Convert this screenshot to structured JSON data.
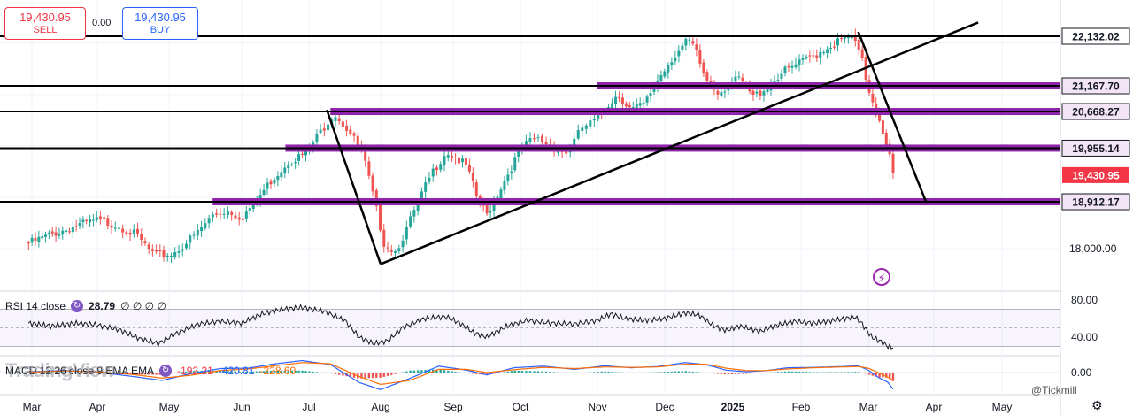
{
  "trade_panel": {
    "sell_price": "19,430.95",
    "sell_label": "SELL",
    "spread": "0.00",
    "buy_price": "19,430.95",
    "buy_label": "BUY"
  },
  "indicators": {
    "rsi": {
      "label": "RSI 14 close",
      "value": "28.79",
      "extra": "∅ ∅ ∅ ∅"
    },
    "macd": {
      "label": "MACD 12 26 close 9 EMA EMA",
      "macd": "-192.21",
      "signal": "-420.81",
      "hist": "-228.60"
    }
  },
  "watermark": "TradingView",
  "credit": "@Tickmill",
  "colors": {
    "up": "#26a69a",
    "down": "#ef5350",
    "level": "#8e24aa",
    "line": "#000000",
    "rsi": "#131722",
    "macd": "#2962ff",
    "signal": "#ff6d00",
    "price_label": "#f23645"
  },
  "icons": {
    "indicator": "loop-icon",
    "alert": "lightning-icon",
    "settings": "gear-icon"
  },
  "chart_data": {
    "type": "candlestick",
    "instrument_price": 19430.95,
    "x_axis": [
      "Mar",
      "Apr",
      "May",
      "Jun",
      "Jul",
      "Aug",
      "Sep",
      "Oct",
      "Nov",
      "Dec",
      "2025",
      "Feb",
      "Mar",
      "Apr",
      "May"
    ],
    "y_axis_labels": [
      "18,000.00"
    ],
    "price_labels": [
      {
        "text": "22,132.02",
        "value": 22132.02,
        "style": "line"
      },
      {
        "text": "21,167.70",
        "value": 21167.7,
        "style": "level"
      },
      {
        "text": "20,668.27",
        "value": 20668.27,
        "style": "level"
      },
      {
        "text": "19,955.14",
        "value": 19955.14,
        "style": "level"
      },
      {
        "text": "19,430.95",
        "value": 19430.95,
        "style": "current"
      },
      {
        "text": "18,912.17",
        "value": 18912.17,
        "style": "level"
      }
    ],
    "horizontal_levels": [
      {
        "value": 22132.02,
        "style": "line",
        "from_month": 0
      },
      {
        "value": 21167.7,
        "style": "level",
        "from_month": 8
      },
      {
        "value": 20668.27,
        "style": "level",
        "from_month": 4.3
      },
      {
        "value": 19955.14,
        "style": "level",
        "from_month": 3.65
      },
      {
        "value": 18912.17,
        "style": "level",
        "from_month": 2.6
      }
    ],
    "black_lines": [
      {
        "value": 21167.7,
        "to_month": 8
      },
      {
        "value": 20668.27,
        "to_month": 4.3
      },
      {
        "value": 19955.14,
        "to_month": 3.65
      },
      {
        "value": 18912.17,
        "to_month": 2.6
      }
    ],
    "trendlines": [
      {
        "p1": [
          4.25,
          20700
        ],
        "p2": [
          5.0,
          17700
        ]
      },
      {
        "p1": [
          5.0,
          17700
        ],
        "p2": [
          13.65,
          22400
        ]
      },
      {
        "p1": [
          11.85,
          22220
        ],
        "p2": [
          12.88,
          18912
        ]
      }
    ],
    "price_path": [
      [
        -0.05,
        18100
      ],
      [
        0.35,
        18300
      ],
      [
        0.7,
        18450
      ],
      [
        1.0,
        18550
      ],
      [
        1.3,
        18450
      ],
      [
        1.55,
        18250
      ],
      [
        1.8,
        17850
      ],
      [
        2.05,
        17900
      ],
      [
        2.35,
        18250
      ],
      [
        2.6,
        18650
      ],
      [
        2.8,
        18750
      ],
      [
        3.0,
        18600
      ],
      [
        3.2,
        18900
      ],
      [
        3.45,
        19350
      ],
      [
        3.7,
        19700
      ],
      [
        3.95,
        19850
      ],
      [
        4.15,
        20250
      ],
      [
        4.35,
        20650
      ],
      [
        4.55,
        20300
      ],
      [
        4.75,
        19850
      ],
      [
        4.95,
        18700
      ],
      [
        5.05,
        18100
      ],
      [
        5.2,
        17950
      ],
      [
        5.35,
        18350
      ],
      [
        5.5,
        18850
      ],
      [
        5.7,
        19450
      ],
      [
        5.9,
        19900
      ],
      [
        6.05,
        19750
      ],
      [
        6.2,
        19600
      ],
      [
        6.35,
        19000
      ],
      [
        6.5,
        18650
      ],
      [
        6.65,
        19050
      ],
      [
        6.85,
        19550
      ],
      [
        7.0,
        19950
      ],
      [
        7.2,
        20150
      ],
      [
        7.4,
        20000
      ],
      [
        7.6,
        19850
      ],
      [
        7.8,
        20350
      ],
      [
        8.0,
        20500
      ],
      [
        8.15,
        20800
      ],
      [
        8.3,
        21000
      ],
      [
        8.5,
        20700
      ],
      [
        8.7,
        20800
      ],
      [
        8.9,
        21300
      ],
      [
        9.1,
        21700
      ],
      [
        9.35,
        22050
      ],
      [
        9.45,
        21850
      ],
      [
        9.6,
        21300
      ],
      [
        9.8,
        21050
      ],
      [
        9.95,
        21200
      ],
      [
        10.1,
        21300
      ],
      [
        10.3,
        20950
      ],
      [
        10.5,
        21150
      ],
      [
        10.7,
        21400
      ],
      [
        10.9,
        21550
      ],
      [
        11.1,
        21700
      ],
      [
        11.3,
        21850
      ],
      [
        11.5,
        22000
      ],
      [
        11.75,
        22130
      ],
      [
        11.9,
        21700
      ],
      [
        12.0,
        21100
      ],
      [
        12.1,
        20800
      ],
      [
        12.2,
        20400
      ],
      [
        12.3,
        19950
      ],
      [
        12.38,
        19431
      ]
    ],
    "rsi": {
      "levels": [
        70,
        50,
        30
      ],
      "ticks": [
        "80.00",
        "40.00"
      ],
      "path": [
        [
          -0.05,
          55
        ],
        [
          0.3,
          52
        ],
        [
          0.7,
          55
        ],
        [
          1.0,
          53
        ],
        [
          1.3,
          48
        ],
        [
          1.6,
          38
        ],
        [
          1.85,
          33
        ],
        [
          2.1,
          44
        ],
        [
          2.4,
          54
        ],
        [
          2.7,
          57
        ],
        [
          3.0,
          55
        ],
        [
          3.3,
          65
        ],
        [
          3.6,
          70
        ],
        [
          3.9,
          72
        ],
        [
          4.2,
          68
        ],
        [
          4.5,
          58
        ],
        [
          4.7,
          40
        ],
        [
          4.9,
          33
        ],
        [
          5.1,
          36
        ],
        [
          5.3,
          50
        ],
        [
          5.6,
          60
        ],
        [
          5.9,
          62
        ],
        [
          6.1,
          55
        ],
        [
          6.3,
          45
        ],
        [
          6.5,
          40
        ],
        [
          6.8,
          52
        ],
        [
          7.1,
          58
        ],
        [
          7.4,
          55
        ],
        [
          7.7,
          54
        ],
        [
          8.0,
          58
        ],
        [
          8.2,
          65
        ],
        [
          8.4,
          60
        ],
        [
          8.7,
          58
        ],
        [
          9.0,
          60
        ],
        [
          9.3,
          66
        ],
        [
          9.5,
          64
        ],
        [
          9.7,
          53
        ],
        [
          9.9,
          47
        ],
        [
          10.1,
          52
        ],
        [
          10.4,
          46
        ],
        [
          10.6,
          52
        ],
        [
          10.9,
          57
        ],
        [
          11.2,
          55
        ],
        [
          11.5,
          58
        ],
        [
          11.8,
          62
        ],
        [
          11.9,
          55
        ],
        [
          12.05,
          40
        ],
        [
          12.2,
          35
        ],
        [
          12.3,
          30
        ],
        [
          12.38,
          29
        ]
      ]
    },
    "macd": {
      "tick": "0.00",
      "macd": [
        [
          -0.05,
          20
        ],
        [
          0.5,
          50
        ],
        [
          1.0,
          10
        ],
        [
          1.5,
          -100
        ],
        [
          1.9,
          -200
        ],
        [
          2.3,
          -30
        ],
        [
          2.7,
          100
        ],
        [
          3.1,
          110
        ],
        [
          3.5,
          220
        ],
        [
          3.9,
          300
        ],
        [
          4.3,
          200
        ],
        [
          4.7,
          -250
        ],
        [
          5.0,
          -430
        ],
        [
          5.4,
          -150
        ],
        [
          5.8,
          160
        ],
        [
          6.2,
          60
        ],
        [
          6.5,
          -60
        ],
        [
          6.9,
          120
        ],
        [
          7.3,
          160
        ],
        [
          7.7,
          80
        ],
        [
          8.1,
          170
        ],
        [
          8.5,
          120
        ],
        [
          8.9,
          150
        ],
        [
          9.3,
          250
        ],
        [
          9.6,
          200
        ],
        [
          9.9,
          60
        ],
        [
          10.2,
          20
        ],
        [
          10.5,
          50
        ],
        [
          10.8,
          120
        ],
        [
          11.2,
          130
        ],
        [
          11.6,
          150
        ],
        [
          11.85,
          170
        ],
        [
          12.0,
          60
        ],
        [
          12.15,
          -120
        ],
        [
          12.3,
          -250
        ],
        [
          12.38,
          -420
        ]
      ],
      "signal": [
        [
          -0.05,
          10
        ],
        [
          0.5,
          40
        ],
        [
          1.0,
          20
        ],
        [
          1.5,
          -50
        ],
        [
          1.9,
          -140
        ],
        [
          2.3,
          -70
        ],
        [
          2.7,
          50
        ],
        [
          3.1,
          90
        ],
        [
          3.5,
          170
        ],
        [
          3.9,
          250
        ],
        [
          4.3,
          220
        ],
        [
          4.7,
          -100
        ],
        [
          5.0,
          -300
        ],
        [
          5.4,
          -200
        ],
        [
          5.8,
          80
        ],
        [
          6.2,
          80
        ],
        [
          6.5,
          0
        ],
        [
          6.9,
          70
        ],
        [
          7.3,
          130
        ],
        [
          7.7,
          100
        ],
        [
          8.1,
          140
        ],
        [
          8.5,
          130
        ],
        [
          8.9,
          140
        ],
        [
          9.3,
          210
        ],
        [
          9.6,
          210
        ],
        [
          9.9,
          110
        ],
        [
          10.2,
          50
        ],
        [
          10.5,
          50
        ],
        [
          10.8,
          90
        ],
        [
          11.2,
          120
        ],
        [
          11.6,
          140
        ],
        [
          11.85,
          150
        ],
        [
          12.0,
          110
        ],
        [
          12.15,
          0
        ],
        [
          12.3,
          -120
        ],
        [
          12.38,
          -200
        ]
      ]
    }
  }
}
